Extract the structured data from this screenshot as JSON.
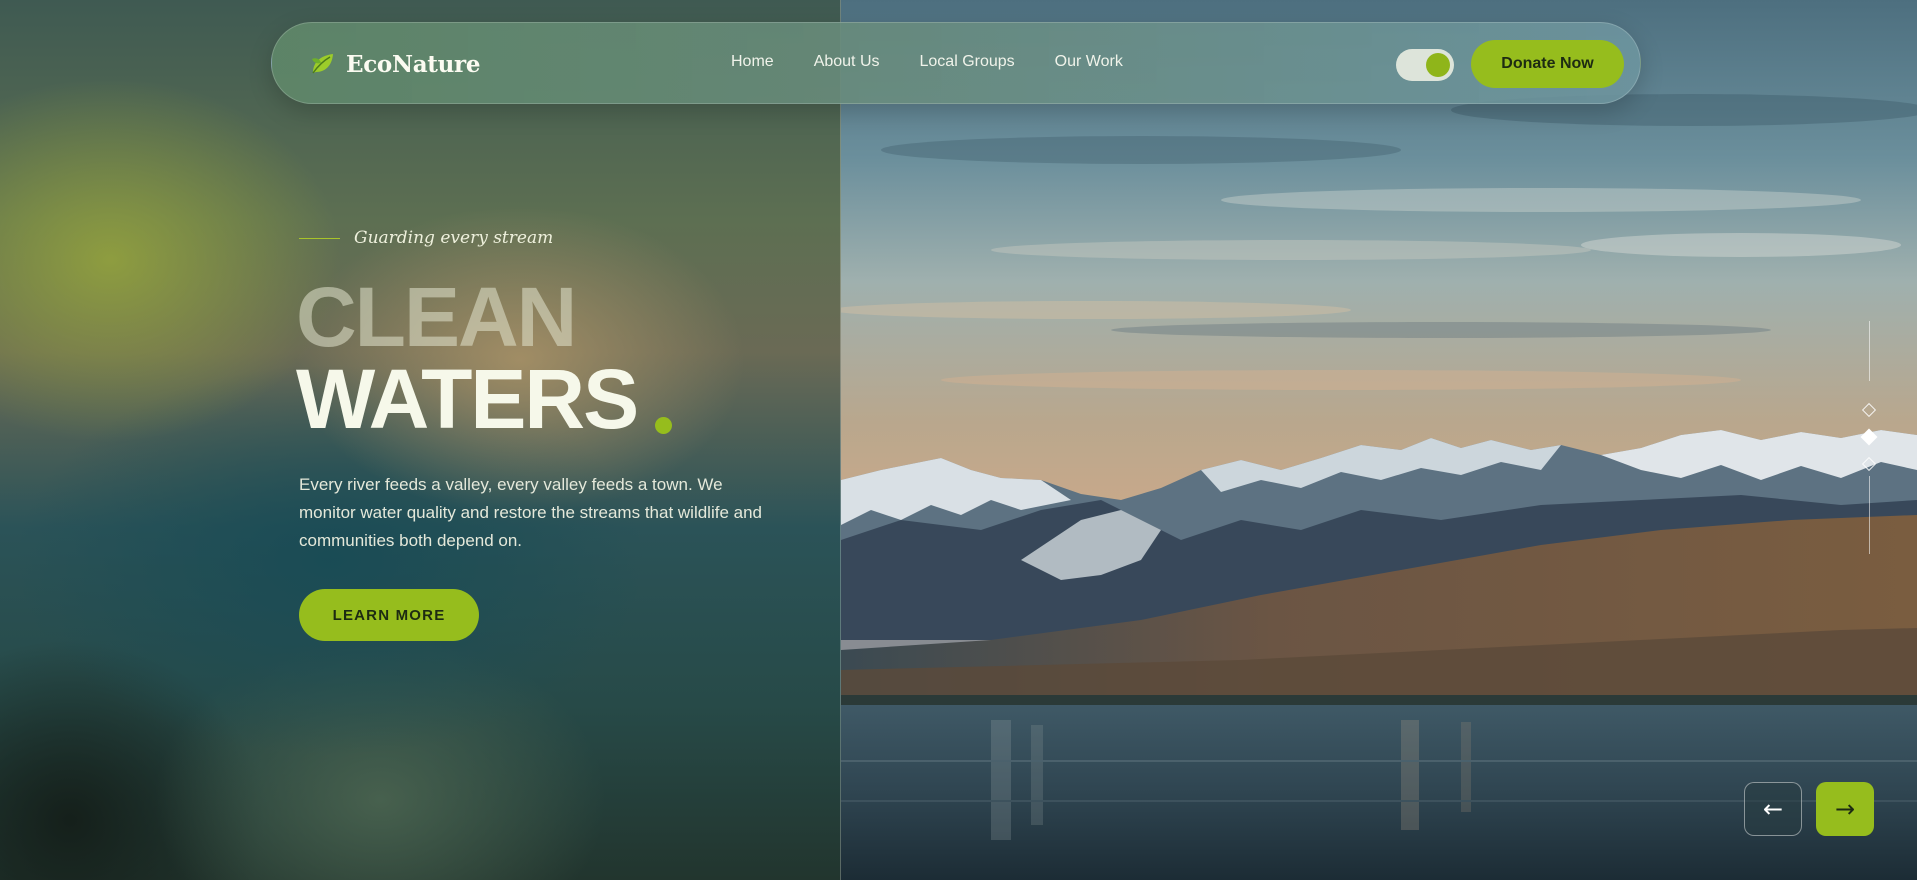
{
  "brand": {
    "name": "EcoNature",
    "icon": "leaf-icon"
  },
  "nav": {
    "links": [
      "Home",
      "About Us",
      "Local Groups",
      "Our Work"
    ],
    "toggle": {
      "state": "on"
    },
    "donate_label": "Donate Now"
  },
  "hero": {
    "eyebrow": "Guarding every stream",
    "headline_line1": "CLEAN",
    "headline_line2": "WATERS",
    "description": "Every river feeds a valley, every valley feeds a town. We monitor water quality and restore the streams that wildlife and communities both depend on.",
    "cta_label": "LEARN MORE"
  },
  "slider": {
    "slide_count": 3,
    "active_slide": 2,
    "prev_symbol": "←",
    "next_symbol": "→"
  },
  "colors": {
    "accent": "#96bd1d",
    "text_light": "#f6f8ea"
  }
}
